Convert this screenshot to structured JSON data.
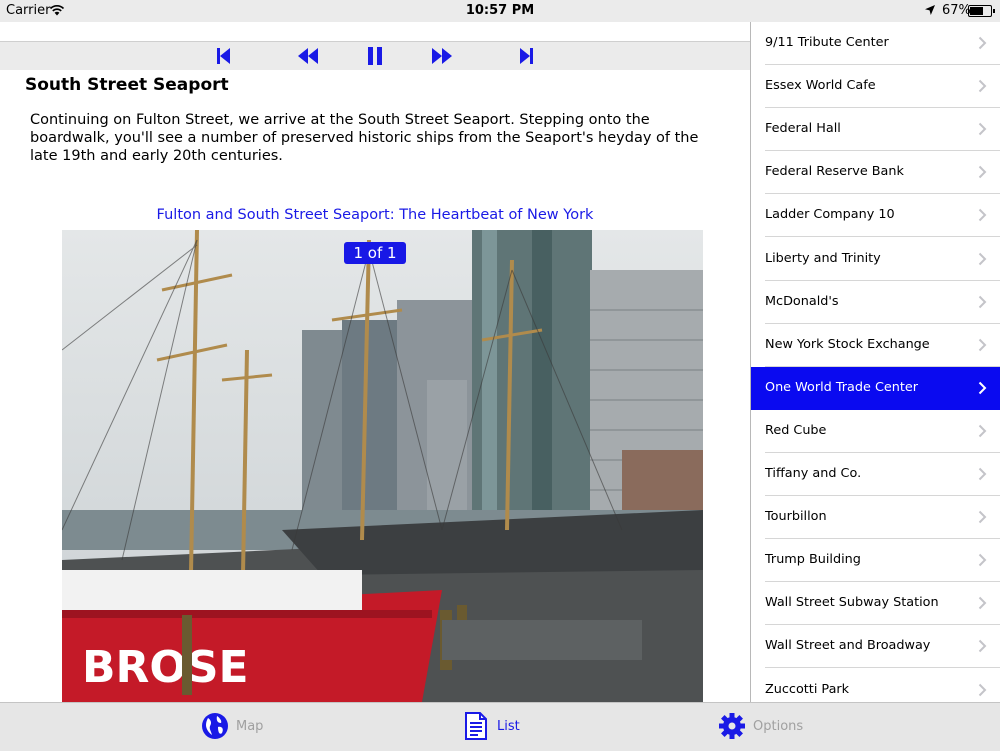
{
  "status_bar": {
    "carrier": "Carrier",
    "time": "10:57 PM",
    "battery": "67%",
    "battery_level": 0.67
  },
  "player": {
    "buttons": [
      "skip-to-start",
      "rewind",
      "pause",
      "fast-forward",
      "skip-to-end"
    ],
    "accent": "#1a1ae6"
  },
  "article": {
    "title": "South Street Seaport",
    "body": "Continuing on Fulton Street, we arrive at the South Street Seaport. Stepping onto the boardwalk, you'll see a number of preserved historic ships from the Seaport's heyday of the late 19th and early 20th centuries.",
    "caption": "Fulton and South Street Seaport: The Heartbeat of New York",
    "photo_counter": "1 of 1"
  },
  "list": {
    "selected_color": "#0a0af0",
    "items": [
      {
        "label": "9/11 Tribute Center",
        "selected": false
      },
      {
        "label": "Essex World Cafe",
        "selected": false
      },
      {
        "label": "Federal Hall",
        "selected": false
      },
      {
        "label": "Federal Reserve Bank",
        "selected": false
      },
      {
        "label": "Ladder Company 10",
        "selected": false
      },
      {
        "label": "Liberty and Trinity",
        "selected": false
      },
      {
        "label": "McDonald's",
        "selected": false
      },
      {
        "label": "New York Stock Exchange",
        "selected": false
      },
      {
        "label": "One World Trade Center",
        "selected": true
      },
      {
        "label": "Red Cube",
        "selected": false
      },
      {
        "label": "Tiffany and Co.",
        "selected": false
      },
      {
        "label": "Tourbillon",
        "selected": false
      },
      {
        "label": "Trump Building",
        "selected": false
      },
      {
        "label": "Wall Street Subway Station",
        "selected": false
      },
      {
        "label": "Wall Street and Broadway",
        "selected": false
      },
      {
        "label": "Zuccotti Park",
        "selected": false
      }
    ]
  },
  "tabbar": {
    "tabs": [
      {
        "label": "Map",
        "icon": "globe-icon"
      },
      {
        "label": "List",
        "icon": "document-icon"
      },
      {
        "label": "Options",
        "icon": "gear-icon"
      }
    ]
  }
}
